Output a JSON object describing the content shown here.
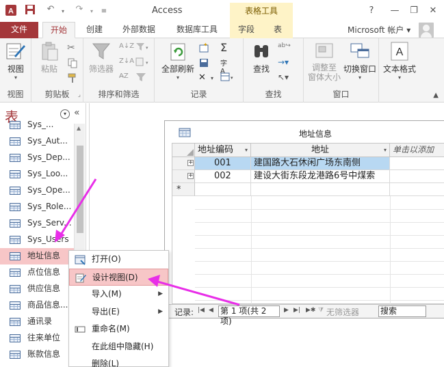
{
  "window": {
    "title": "Access",
    "context_tab_header": "表格工具",
    "help": "?",
    "minimize": "—",
    "restore": "❐",
    "close": "✕"
  },
  "ribbon_tabs": [
    {
      "label": "文件"
    },
    {
      "label": "开始"
    },
    {
      "label": "创建"
    },
    {
      "label": "外部数据"
    },
    {
      "label": "数据库工具"
    },
    {
      "label": "字段"
    },
    {
      "label": "表"
    }
  ],
  "account": {
    "label": "Microsoft 帐户 ▾"
  },
  "ribbon": {
    "view": {
      "button": "视图",
      "group": "视图"
    },
    "clipboard": {
      "paste": "粘贴",
      "group": "剪贴板"
    },
    "sortfilter": {
      "filter": "筛选器",
      "group": "排序和筛选"
    },
    "records": {
      "refresh": "全部刷新",
      "group": "记录"
    },
    "find": {
      "find": "查找",
      "group": "查找"
    },
    "window": {
      "resize": "调整至\n窗体大小",
      "resize_l1": "调整至",
      "resize_l2": "窗体大小",
      "switch": "切换窗口",
      "group": "窗口"
    },
    "text": {
      "format": "文本格式"
    }
  },
  "nav": {
    "title": "表",
    "items": [
      {
        "label": "Sys_..."
      },
      {
        "label": "Sys_Aut..."
      },
      {
        "label": "Sys_Dep..."
      },
      {
        "label": "Sys_Loo..."
      },
      {
        "label": "Sys_Ope..."
      },
      {
        "label": "Sys_Role..."
      },
      {
        "label": "Sys_Serv..."
      },
      {
        "label": "Sys_Users"
      },
      {
        "label": "地址信息"
      },
      {
        "label": "点位信息"
      },
      {
        "label": "供应信息"
      },
      {
        "label": "商品信息..."
      },
      {
        "label": "通讯录"
      },
      {
        "label": "往来单位"
      },
      {
        "label": "账款信息"
      }
    ]
  },
  "form": {
    "title": "地址信息",
    "columns": [
      "地址编码",
      "地址",
      "单击以添加"
    ],
    "rows": [
      {
        "code": "001",
        "address": "建国路大石休闲广场东南侧"
      },
      {
        "code": "002",
        "address": "建设大街东段龙港路6号中煤索"
      }
    ],
    "new_row_marker": "*",
    "record_nav": {
      "label": "记录:",
      "current": "第 1 项(共 2 项)",
      "no_filter": "无筛选器",
      "search": "搜索"
    }
  },
  "context_menu": {
    "items": [
      {
        "label": "打开(O)"
      },
      {
        "label": "设计视图(D)"
      },
      {
        "label": "导入(M)"
      },
      {
        "label": "导出(E)"
      },
      {
        "label": "重命名(M)"
      },
      {
        "label": "在此组中隐藏(H)"
      },
      {
        "label": "删除(L)"
      }
    ]
  },
  "colors": {
    "accent": "#a4373a",
    "selection": "#f7c6c7",
    "arrow": "#e82ee8",
    "context_tab": "#fef3c7"
  }
}
